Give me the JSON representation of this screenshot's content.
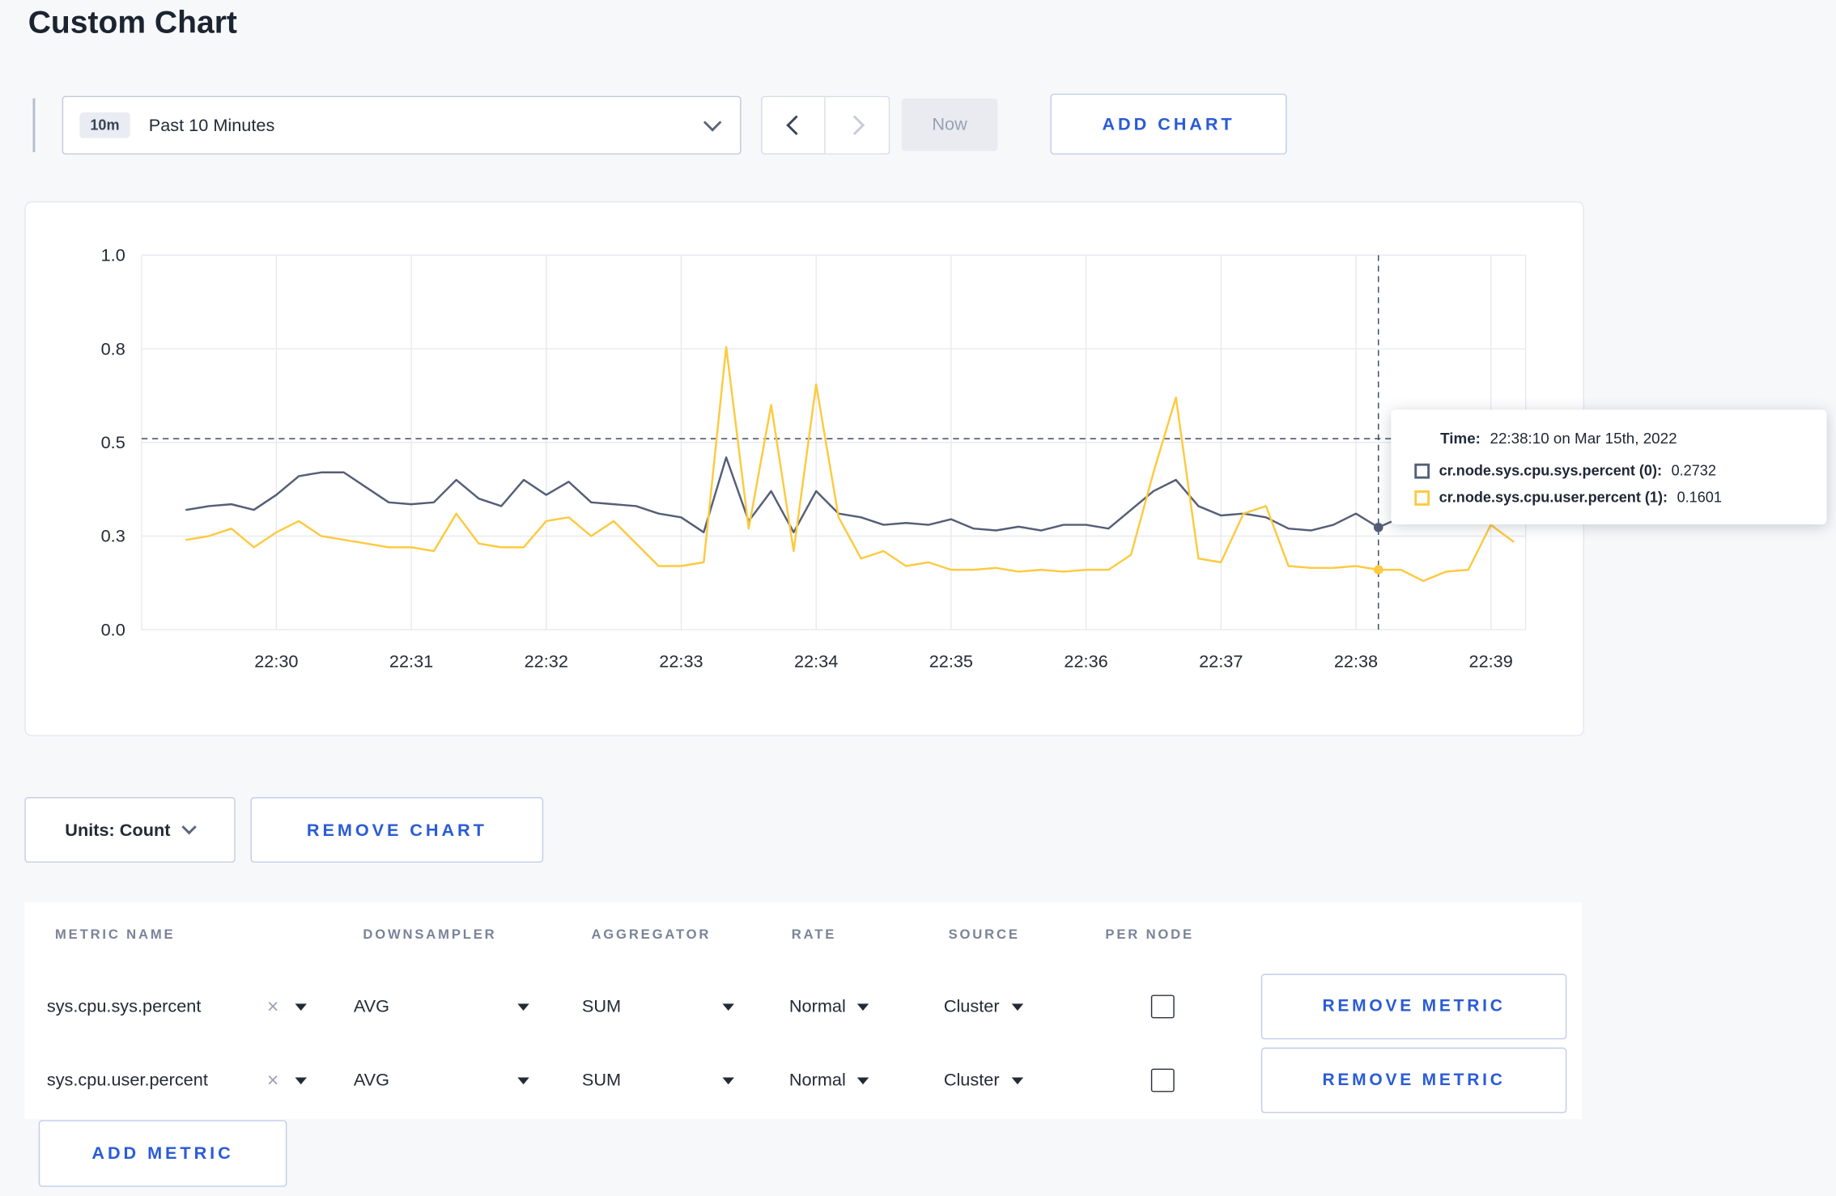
{
  "page": {
    "title": "Custom Chart"
  },
  "icons": {
    "clear": "×"
  },
  "toolbar": {
    "time_range": {
      "badge": "10m",
      "label": "Past 10 Minutes"
    },
    "now_label": "Now",
    "add_chart_label": "ADD CHART"
  },
  "tooltip": {
    "time_label": "Time:",
    "time_value": "22:38:10 on Mar 15th, 2022",
    "series": [
      {
        "name": "cr.node.sys.cpu.sys.percent (0):",
        "value": "0.2732",
        "color": "#545f77"
      },
      {
        "name": "cr.node.sys.cpu.user.percent (1):",
        "value": "0.1601",
        "color": "#fdca40"
      }
    ]
  },
  "chart_controls": {
    "units_label": "Units: Count",
    "remove_chart_label": "REMOVE CHART"
  },
  "metrics_table": {
    "headers": [
      "METRIC NAME",
      "DOWNSAMPLER",
      "AGGREGATOR",
      "RATE",
      "SOURCE",
      "PER NODE"
    ],
    "rows": [
      {
        "metric": "sys.cpu.sys.percent",
        "downsampler": "AVG",
        "aggregator": "SUM",
        "rate": "Normal",
        "source": "Cluster",
        "per_node_checked": false,
        "remove_label": "REMOVE METRIC"
      },
      {
        "metric": "sys.cpu.user.percent",
        "downsampler": "AVG",
        "aggregator": "SUM",
        "rate": "Normal",
        "source": "Cluster",
        "per_node_checked": false,
        "remove_label": "REMOVE METRIC"
      }
    ],
    "add_metric_label": "ADD METRIC"
  },
  "chart_data": {
    "type": "line",
    "title": "",
    "x_ticks": [
      "22:30",
      "22:31",
      "22:32",
      "22:33",
      "22:34",
      "22:35",
      "22:36",
      "22:37",
      "22:38",
      "22:39"
    ],
    "y_ticks": {
      "values": [
        0,
        0.25,
        0.5,
        0.75,
        1.0
      ],
      "labels": [
        "0.0",
        "0.3",
        "0.5",
        "0.8",
        "1.0"
      ]
    },
    "ylim": [
      0,
      1
    ],
    "interval_seconds": 10,
    "x_start_min": -0.6667,
    "grid": true,
    "crosshair": {
      "index": 53,
      "time": "22:38:10",
      "y_value": 0.51
    },
    "series": [
      {
        "name": "cr.node.sys.cpu.sys.percent",
        "color": "#545f77",
        "values": [
          0.32,
          0.33,
          0.335,
          0.32,
          0.36,
          0.41,
          0.42,
          0.42,
          0.38,
          0.34,
          0.335,
          0.34,
          0.4,
          0.35,
          0.33,
          0.4,
          0.36,
          0.395,
          0.34,
          0.335,
          0.33,
          0.31,
          0.3,
          0.26,
          0.46,
          0.29,
          0.37,
          0.26,
          0.37,
          0.31,
          0.3,
          0.28,
          0.285,
          0.28,
          0.295,
          0.27,
          0.265,
          0.275,
          0.265,
          0.28,
          0.28,
          0.27,
          0.32,
          0.37,
          0.4,
          0.33,
          0.305,
          0.31,
          0.3,
          0.27,
          0.265,
          0.28,
          0.31,
          0.2732,
          0.3,
          0.295,
          0.31,
          0.295,
          0.3,
          0.315
        ]
      },
      {
        "name": "cr.node.sys.cpu.user.percent",
        "color": "#fdca40",
        "values": [
          0.24,
          0.25,
          0.27,
          0.22,
          0.26,
          0.29,
          0.25,
          0.24,
          0.23,
          0.22,
          0.22,
          0.21,
          0.31,
          0.23,
          0.22,
          0.22,
          0.29,
          0.3,
          0.25,
          0.29,
          0.23,
          0.17,
          0.17,
          0.18,
          0.755,
          0.27,
          0.6,
          0.21,
          0.655,
          0.3,
          0.19,
          0.21,
          0.17,
          0.18,
          0.16,
          0.16,
          0.165,
          0.155,
          0.16,
          0.155,
          0.16,
          0.16,
          0.2,
          0.42,
          0.62,
          0.19,
          0.18,
          0.31,
          0.33,
          0.17,
          0.165,
          0.165,
          0.17,
          0.1601,
          0.16,
          0.13,
          0.155,
          0.16,
          0.28,
          0.235
        ]
      }
    ]
  }
}
